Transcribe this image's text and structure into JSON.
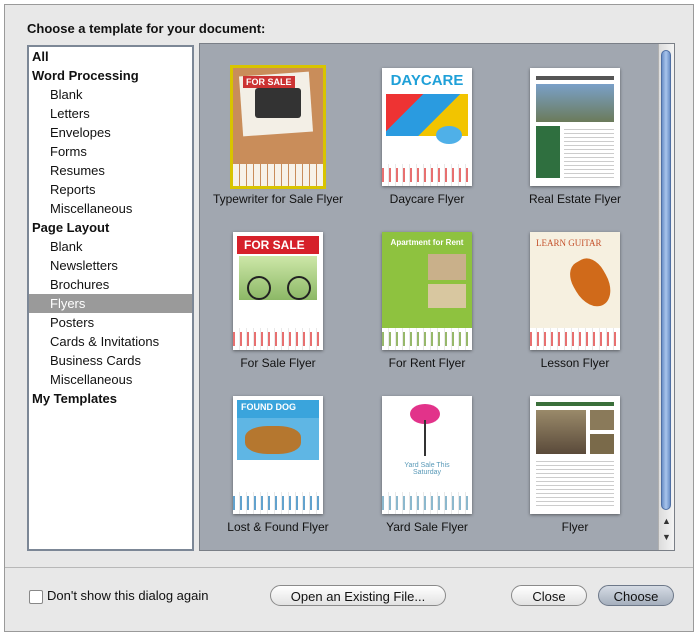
{
  "header": {
    "prompt": "Choose a template for your document:"
  },
  "sidebar": {
    "items": [
      {
        "label": "All",
        "level": "heading",
        "selected": false
      },
      {
        "label": "Word Processing",
        "level": "heading",
        "selected": false
      },
      {
        "label": "Blank",
        "level": "child",
        "selected": false
      },
      {
        "label": "Letters",
        "level": "child",
        "selected": false
      },
      {
        "label": "Envelopes",
        "level": "child",
        "selected": false
      },
      {
        "label": "Forms",
        "level": "child",
        "selected": false
      },
      {
        "label": "Resumes",
        "level": "child",
        "selected": false
      },
      {
        "label": "Reports",
        "level": "child",
        "selected": false
      },
      {
        "label": "Miscellaneous",
        "level": "child",
        "selected": false
      },
      {
        "label": "Page Layout",
        "level": "heading",
        "selected": false
      },
      {
        "label": "Blank",
        "level": "child",
        "selected": false
      },
      {
        "label": "Newsletters",
        "level": "child",
        "selected": false
      },
      {
        "label": "Brochures",
        "level": "child",
        "selected": false
      },
      {
        "label": "Flyers",
        "level": "child",
        "selected": true
      },
      {
        "label": "Posters",
        "level": "child",
        "selected": false
      },
      {
        "label": "Cards & Invitations",
        "level": "child",
        "selected": false
      },
      {
        "label": "Business Cards",
        "level": "child",
        "selected": false
      },
      {
        "label": "Miscellaneous",
        "level": "child",
        "selected": false
      },
      {
        "label": "My Templates",
        "level": "heading",
        "selected": false
      }
    ]
  },
  "templates": [
    {
      "label": "Typewriter for Sale Flyer",
      "selected": true,
      "thumb_text": "FOR SALE"
    },
    {
      "label": "Daycare Flyer",
      "selected": false,
      "thumb_text": "DAYCARE"
    },
    {
      "label": "Real Estate Flyer",
      "selected": false,
      "thumb_text": ""
    },
    {
      "label": "For Sale Flyer",
      "selected": false,
      "thumb_text": "FOR SALE"
    },
    {
      "label": "For Rent Flyer",
      "selected": false,
      "thumb_text": "Apartment for Rent"
    },
    {
      "label": "Lesson Flyer",
      "selected": false,
      "thumb_text": "LEARN GUITAR"
    },
    {
      "label": "Lost & Found Flyer",
      "selected": false,
      "thumb_text": "FOUND DOG"
    },
    {
      "label": "Yard Sale Flyer",
      "selected": false,
      "thumb_text": "Yard Sale This Saturday"
    },
    {
      "label": "Flyer",
      "selected": false,
      "thumb_text": ""
    }
  ],
  "footer": {
    "dont_show_label": "Don't show this dialog again",
    "dont_show_checked": false,
    "open_existing_label": "Open an Existing File...",
    "close_label": "Close",
    "choose_label": "Choose"
  },
  "colors": {
    "grid_background": "#a1a7b0",
    "selected_row": "#9a9a9a",
    "selection_outline": "#d8c400",
    "scroll_thumb": "#7fa3d8"
  }
}
